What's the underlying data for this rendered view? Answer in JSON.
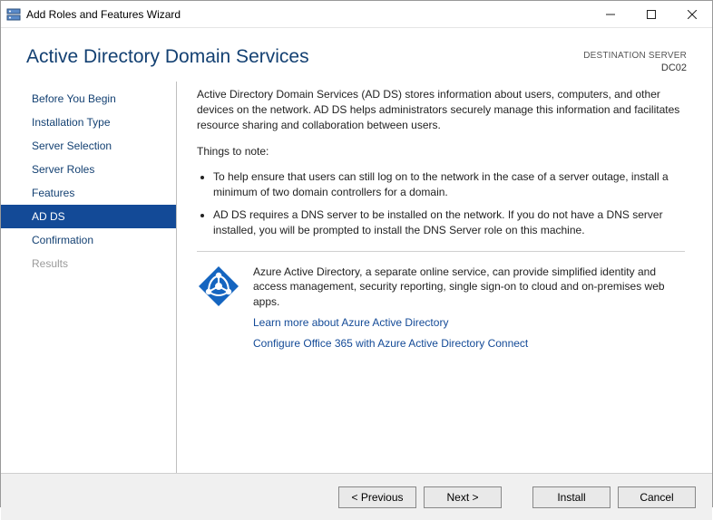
{
  "titlebar": {
    "title": "Add Roles and Features Wizard"
  },
  "header": {
    "title": "Active Directory Domain Services",
    "destination_label": "DESTINATION SERVER",
    "destination_server": "DC02"
  },
  "sidebar": {
    "items": [
      {
        "label": "Before You Begin",
        "state": "normal"
      },
      {
        "label": "Installation Type",
        "state": "normal"
      },
      {
        "label": "Server Selection",
        "state": "normal"
      },
      {
        "label": "Server Roles",
        "state": "normal"
      },
      {
        "label": "Features",
        "state": "normal"
      },
      {
        "label": "AD DS",
        "state": "active"
      },
      {
        "label": "Confirmation",
        "state": "normal"
      },
      {
        "label": "Results",
        "state": "disabled"
      }
    ]
  },
  "content": {
    "intro": "Active Directory Domain Services (AD DS) stores information about users, computers, and other devices on the network.  AD DS helps administrators securely manage this information and facilitates resource sharing and collaboration between users.",
    "notes_title": "Things to note:",
    "notes": [
      "To help ensure that users can still log on to the network in the case of a server outage, install a minimum of two domain controllers for a domain.",
      "AD DS requires a DNS server to be installed on the network.  If you do not have a DNS server installed, you will be prompted to install the DNS Server role on this machine."
    ],
    "azure": {
      "desc": "Azure Active Directory, a separate online service, can provide simplified identity and access management, security reporting, single sign-on to cloud and on-premises web apps.",
      "link1": "Learn more about Azure Active Directory",
      "link2": "Configure Office 365 with Azure Active Directory Connect"
    }
  },
  "footer": {
    "previous": "< Previous",
    "next": "Next >",
    "install": "Install",
    "cancel": "Cancel"
  }
}
